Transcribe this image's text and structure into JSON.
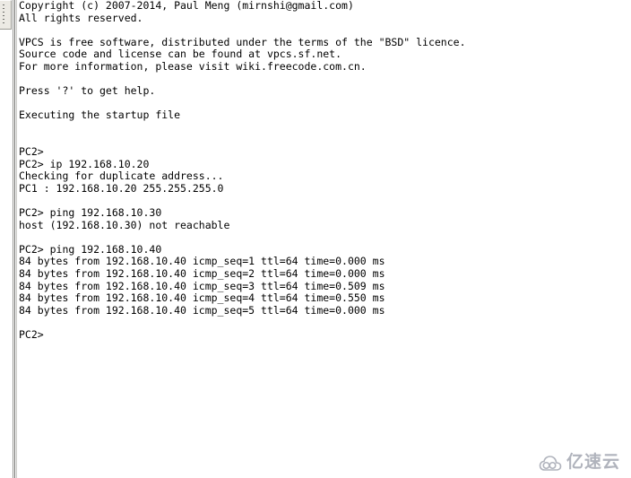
{
  "window": {
    "scrollbar": {
      "thumb_label": "vertical-scroll-thumb",
      "position_percent": 0
    }
  },
  "terminal": {
    "prompt": "PC2>",
    "font_color": "#000000",
    "background_color": "#ffffff",
    "lines": [
      "Copyright (c) 2007-2014, Paul Meng (mirnshi@gmail.com)",
      "All rights reserved.",
      "",
      "VPCS is free software, distributed under the terms of the \"BSD\" licence.",
      "Source code and license can be found at vpcs.sf.net.",
      "For more information, please visit wiki.freecode.com.cn.",
      "",
      "Press '?' to get help.",
      "",
      "Executing the startup file",
      "",
      "",
      "PC2>",
      "PC2> ip 192.168.10.20",
      "Checking for duplicate address...",
      "PC1 : 192.168.10.20 255.255.255.0",
      "",
      "PC2> ping 192.168.10.30",
      "host (192.168.10.30) not reachable",
      "",
      "PC2> ping 192.168.10.40",
      "84 bytes from 192.168.10.40 icmp_seq=1 ttl=64 time=0.000 ms",
      "84 bytes from 192.168.10.40 icmp_seq=2 ttl=64 time=0.000 ms",
      "84 bytes from 192.168.10.40 icmp_seq=3 ttl=64 time=0.509 ms",
      "84 bytes from 192.168.10.40 icmp_seq=4 ttl=64 time=0.550 ms",
      "84 bytes from 192.168.10.40 icmp_seq=5 ttl=64 time=0.000 ms",
      "",
      "PC2>"
    ]
  },
  "watermark": {
    "text": "亿速云",
    "icon": "cloud-icon",
    "color": "#9296a3"
  }
}
